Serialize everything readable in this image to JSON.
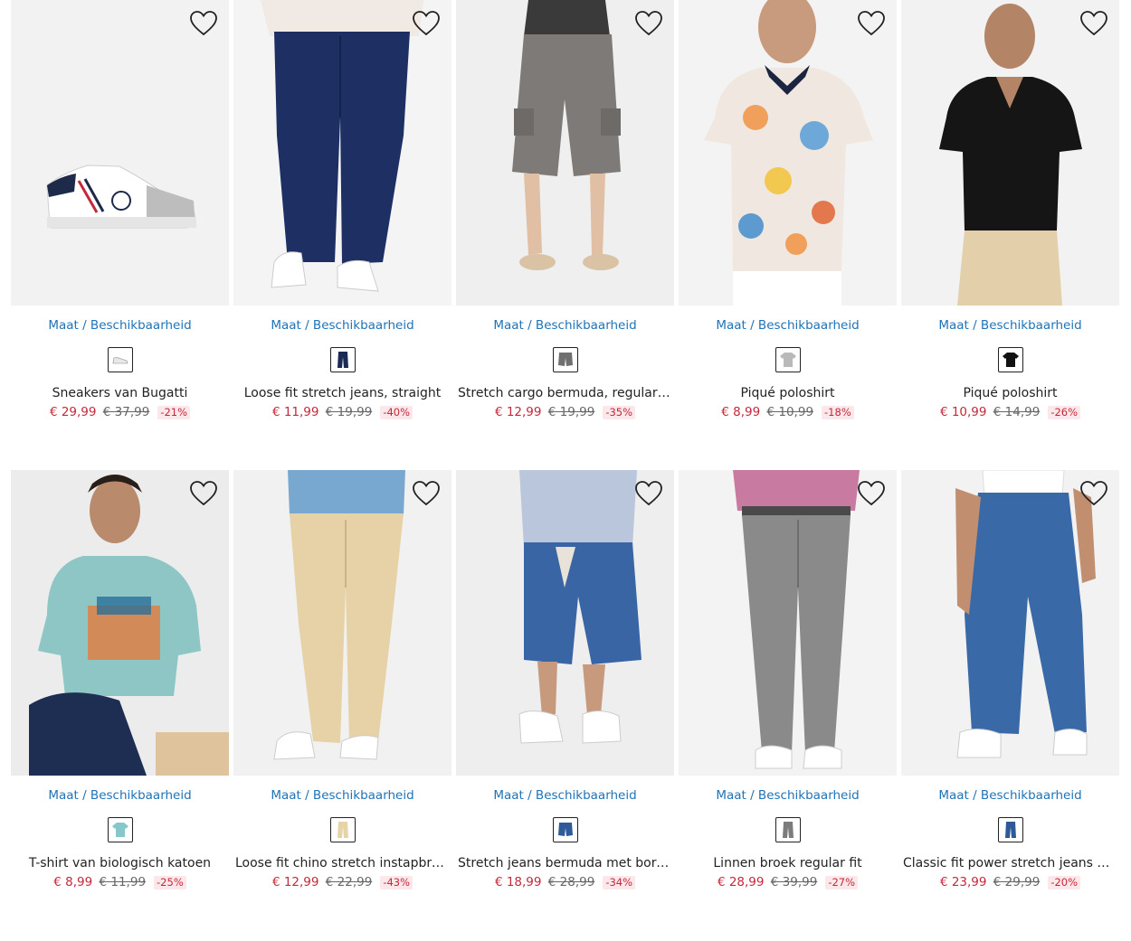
{
  "colors": {
    "link": "#1f73b7",
    "sale": "#c5283a",
    "discount_bg": "#fce8ea"
  },
  "products": [
    {
      "size_link": "Maat / Beschikbaarheid",
      "name": "Sneakers van Bugatti",
      "price": "€ 29,99",
      "old_price": "€ 37,99",
      "discount": "-21%",
      "swatch": "sneaker",
      "swatch_color": "#e8e8e8"
    },
    {
      "size_link": "Maat / Beschikbaarheid",
      "name": "Loose fit stretch jeans, straight",
      "price": "€ 11,99",
      "old_price": "€ 19,99",
      "discount": "-40%",
      "swatch": "pants",
      "swatch_color": "#1b2a55"
    },
    {
      "size_link": "Maat / Beschikbaarheid",
      "name": "Stretch cargo bermuda, regular fit",
      "price": "€ 12,99",
      "old_price": "€ 19,99",
      "discount": "-35%",
      "swatch": "shorts",
      "swatch_color": "#6f6f6f"
    },
    {
      "size_link": "Maat / Beschikbaarheid",
      "name": "Piqué poloshirt",
      "price": "€ 8,99",
      "old_price": "€ 10,99",
      "discount": "-18%",
      "swatch": "shirt",
      "swatch_color": "#b9b9b9"
    },
    {
      "size_link": "Maat / Beschikbaarheid",
      "name": "Piqué poloshirt",
      "price": "€ 10,99",
      "old_price": "€ 14,99",
      "discount": "-26%",
      "swatch": "shirt",
      "swatch_color": "#111111"
    },
    {
      "size_link": "Maat / Beschikbaarheid",
      "name": "T-shirt van biologisch katoen",
      "price": "€ 8,99",
      "old_price": "€ 11,99",
      "discount": "-25%",
      "swatch": "shirt",
      "swatch_color": "#86c7cc"
    },
    {
      "size_link": "Maat / Beschikbaarheid",
      "name": "Loose fit chino stretch instapbroek…",
      "price": "€ 12,99",
      "old_price": "€ 22,99",
      "discount": "-43%",
      "swatch": "pants",
      "swatch_color": "#e6d3a8"
    },
    {
      "size_link": "Maat / Beschikbaarheid",
      "name": "Stretch jeans bermuda met borduu…",
      "price": "€ 18,99",
      "old_price": "€ 28,99",
      "discount": "-34%",
      "swatch": "shorts",
      "swatch_color": "#2f5a9a"
    },
    {
      "size_link": "Maat / Beschikbaarheid",
      "name": "Linnen broek regular fit",
      "price": "€ 28,99",
      "old_price": "€ 39,99",
      "discount": "-27%",
      "swatch": "pants",
      "swatch_color": "#7c7c7c"
    },
    {
      "size_link": "Maat / Beschikbaarheid",
      "name": "Classic fit power stretch jeans met …",
      "price": "€ 23,99",
      "old_price": "€ 29,99",
      "discount": "-20%",
      "swatch": "pants",
      "swatch_color": "#2e5996"
    }
  ]
}
